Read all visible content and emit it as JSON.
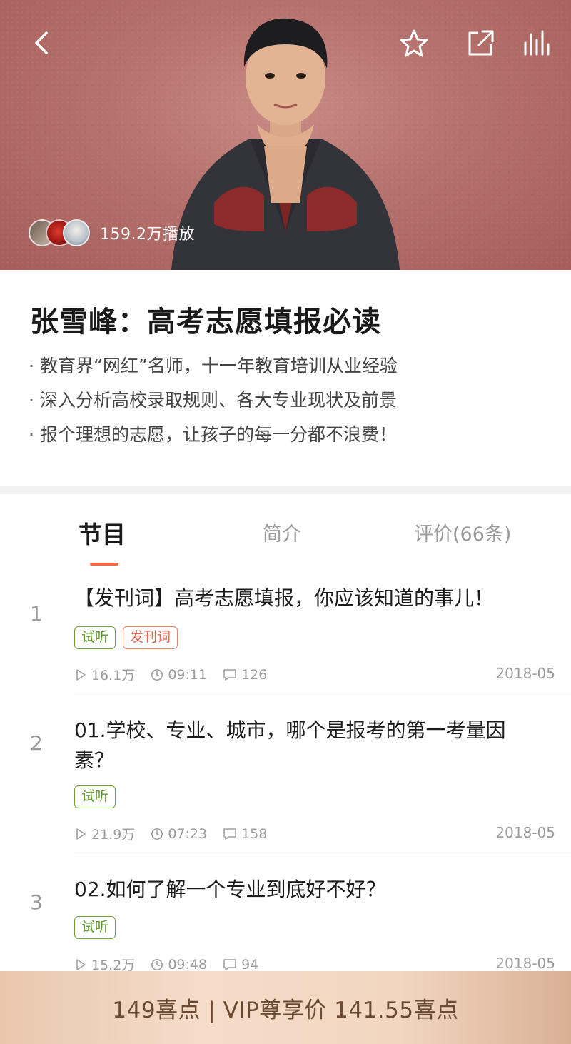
{
  "header": {
    "play_count": "159.2万播放"
  },
  "course": {
    "title": "张雪峰：高考志愿填报必读",
    "features": [
      "教育界“网红”名师，十一年教育培训从业经验",
      "深入分析高校录取规则、各大专业现状及前景",
      "报个理想的志愿，让孩子的每一分都不浪费！"
    ]
  },
  "tabs": [
    {
      "label": "节目",
      "active": true
    },
    {
      "label": "简介",
      "active": false
    },
    {
      "label": "评价(66条)",
      "active": false
    }
  ],
  "episodes": [
    {
      "number": "1",
      "title": "【发刊词】高考志愿填报，你应该知道的事儿！",
      "tags": [
        "试听",
        "发刊词"
      ],
      "plays": "16.1万",
      "duration": "09:11",
      "comments": "126",
      "date": "2018-05"
    },
    {
      "number": "2",
      "title": "01.学校、专业、城市，哪个是报考的第一考量因素？",
      "tags": [
        "试听"
      ],
      "plays": "21.9万",
      "duration": "07:23",
      "comments": "158",
      "date": "2018-05"
    },
    {
      "number": "3",
      "title": "02.如何了解一个专业到底好不好？",
      "tags": [
        "试听"
      ],
      "plays": "15.2万",
      "duration": "09:48",
      "comments": "94",
      "date": "2018-05"
    }
  ],
  "purchase": {
    "label": "149喜点 | VIP尊享价 141.55喜点"
  },
  "colors": {
    "accent": "#f06a4a",
    "tag_green": "#5f9a2d",
    "tag_red": "#e06650",
    "buy_bar": "#f2d6c0"
  },
  "icons": {
    "back": "chevron-left-icon",
    "favorite": "star-icon",
    "share": "share-icon",
    "audio": "equalizer-icon",
    "play": "play-icon",
    "clock": "clock-icon",
    "comment": "comment-icon"
  }
}
